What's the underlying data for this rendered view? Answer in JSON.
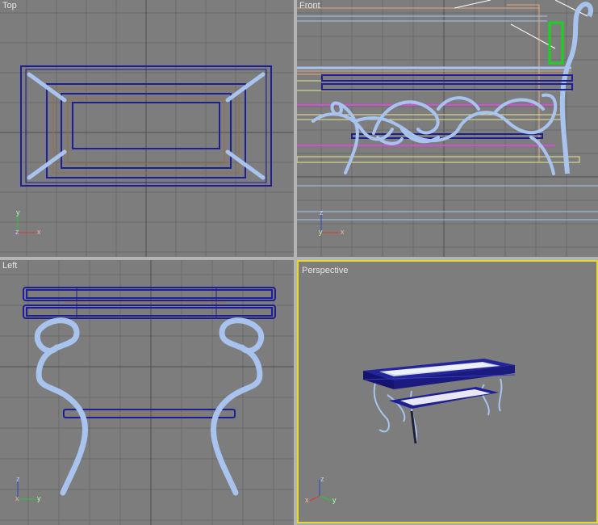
{
  "viewports": {
    "top": {
      "label": "Top",
      "axes": {
        "up": "y",
        "right": "x",
        "origin": "z"
      }
    },
    "front": {
      "label": "Front",
      "axes": {
        "up": "z",
        "right": "x",
        "origin": "y"
      }
    },
    "left": {
      "label": "Left",
      "axes": {
        "up": "z",
        "right": "y",
        "origin": "x"
      }
    },
    "perspective": {
      "label": "Perspective",
      "axes": {
        "up": "z",
        "right": "y",
        "origin": "x"
      }
    }
  },
  "colors": {
    "viewport_bg": "#7d7d7d",
    "grid": "#6a6a6a",
    "grid_major": "#505050",
    "active_border": "#e8d82a",
    "frame_blue": "#1e1e96",
    "iron_light_blue": "#a8c4ee",
    "axis_x": "#d23c28",
    "axis_y": "#28c83c",
    "axis_z": "#2846c8"
  }
}
